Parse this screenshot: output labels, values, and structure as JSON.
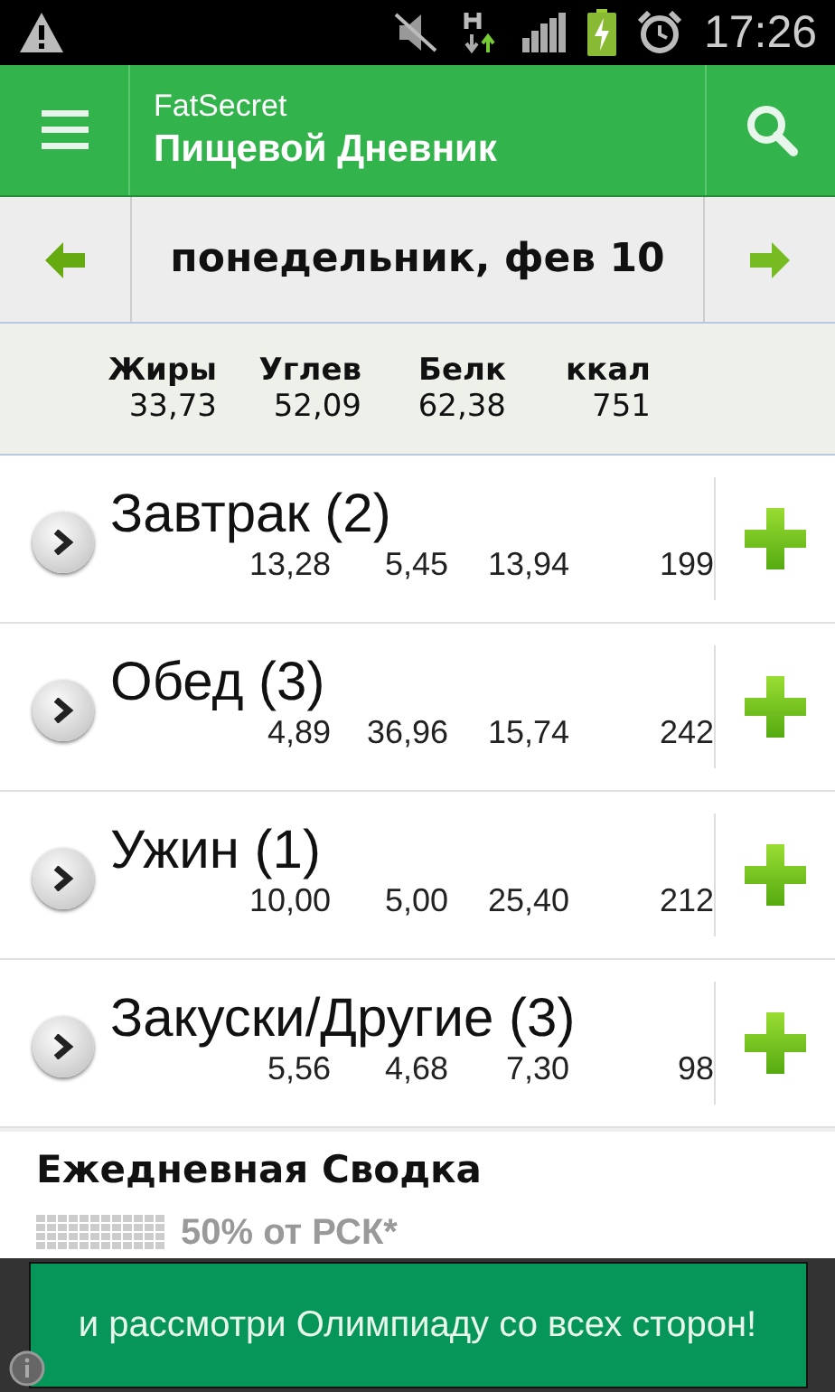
{
  "status_bar": {
    "time": "17:26"
  },
  "app_bar": {
    "brand": "FatSecret",
    "title": "Пищевой Дневник"
  },
  "date_nav": {
    "date": "понедельник, фев 10"
  },
  "totals": {
    "columns": [
      "Жиры",
      "Углев",
      "Белк",
      "ккал"
    ],
    "values": [
      "33,73",
      "52,09",
      "62,38",
      "751"
    ]
  },
  "meals": [
    {
      "name": "Завтрак (2)",
      "values": [
        "13,28",
        "5,45",
        "13,94",
        "199"
      ]
    },
    {
      "name": "Обед (3)",
      "values": [
        "4,89",
        "36,96",
        "15,74",
        "242"
      ]
    },
    {
      "name": "Ужин (1)",
      "values": [
        "10,00",
        "5,00",
        "25,40",
        "212"
      ]
    },
    {
      "name": "Закуски/Другие (3)",
      "values": [
        "5,56",
        "4,68",
        "7,30",
        "98"
      ]
    }
  ],
  "summary": {
    "title": "Ежедневная Сводка",
    "label": "50% от РСК*"
  },
  "ad": {
    "text": "и рассмотри Олимпиаду со всех сторон!"
  }
}
